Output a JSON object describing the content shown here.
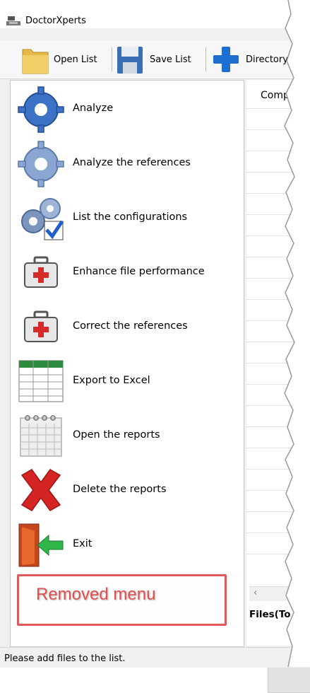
{
  "window": {
    "title": "DoctorXperts"
  },
  "toolbar": {
    "open_label": "Open List",
    "save_label": "Save List",
    "directory_label": "Directory"
  },
  "menu": {
    "items": [
      {
        "label": "Analyze",
        "icon": "gear-icon"
      },
      {
        "label": "Analyze the references",
        "icon": "gear-icon"
      },
      {
        "label": "List the configurations",
        "icon": "gears-check-icon"
      },
      {
        "label": "Enhance file performance",
        "icon": "first-aid-kit-icon"
      },
      {
        "label": "Correct the references",
        "icon": "first-aid-kit-icon"
      },
      {
        "label": "Export to Excel",
        "icon": "spreadsheet-icon"
      },
      {
        "label": "Open the reports",
        "icon": "calendar-icon"
      },
      {
        "label": "Delete the reports",
        "icon": "red-x-icon"
      },
      {
        "label": "Exit",
        "icon": "exit-door-icon"
      }
    ],
    "removed_label": "Removed menu"
  },
  "list": {
    "column_header": "Compl",
    "files_label": "Files(To"
  },
  "status": {
    "text": "Please add files to the list."
  },
  "colors": {
    "annotation": "#e05050",
    "accent_blue": "#1f6fd1"
  }
}
